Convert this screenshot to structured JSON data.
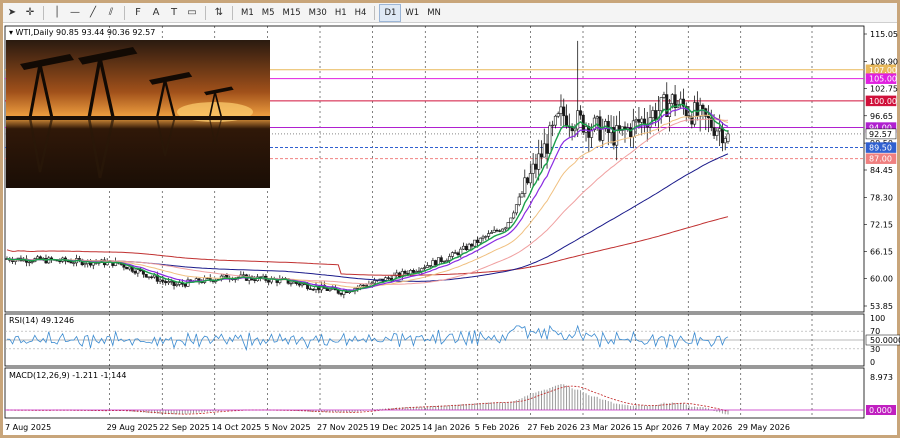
{
  "toolbar": {
    "tools": [
      {
        "name": "cursor-icon",
        "glyph": "➤"
      },
      {
        "name": "crosshair-icon",
        "glyph": "✛"
      },
      {
        "name": "vertical-line-icon",
        "glyph": "│"
      },
      {
        "name": "horizontal-line-icon",
        "glyph": "—"
      },
      {
        "name": "trendline-icon",
        "glyph": "╱"
      },
      {
        "name": "equidistant-channel-icon",
        "glyph": "⫽"
      },
      {
        "name": "fibonacci-icon",
        "glyph": "F"
      },
      {
        "name": "text-icon",
        "glyph": "A"
      },
      {
        "name": "text-label-icon",
        "glyph": "T"
      },
      {
        "name": "rectangle-label-icon",
        "glyph": "▭"
      },
      {
        "name": "arrows-icon",
        "glyph": "⇅"
      }
    ],
    "timeframes_intraday": [
      "M1",
      "M5",
      "M15",
      "M30",
      "H1",
      "H4"
    ],
    "timeframes_daily": [
      "D1",
      "W1",
      "MN"
    ],
    "active_timeframe": "D1"
  },
  "chart": {
    "header_label": "WTI,Daily",
    "header_values": "90.85 93.44 90.36 92.57",
    "price_ticks": [
      "115.05",
      "108.90",
      "102.75",
      "96.65",
      "90.50",
      "84.45",
      "78.30",
      "72.15",
      "66.15",
      "60.00",
      "53.85"
    ],
    "price_tags": [
      {
        "text": "107.00",
        "bg": "#e8b85a",
        "fg": "#ffffff"
      },
      {
        "text": "105.00",
        "bg": "#e020e0",
        "fg": "#ffffff"
      },
      {
        "text": "100.00",
        "bg": "#d0103a",
        "fg": "#ffffff"
      },
      {
        "text": "94.00",
        "bg": "#b020d0",
        "fg": "#ffffff"
      },
      {
        "text": "92.57",
        "bg": "#ffffff",
        "fg": "#000000"
      },
      {
        "text": "89.50",
        "bg": "#3060d0",
        "fg": "#ffffff"
      },
      {
        "text": "87.00",
        "bg": "#f08080",
        "fg": "#ffffff"
      }
    ]
  },
  "rsi": {
    "label": "RSI(14) 49.1246",
    "ticks": [
      "100",
      "70",
      "50.0000",
      "30",
      "0"
    ],
    "current_value": 49.12
  },
  "macd": {
    "label": "MACD(12,26,9) -1.211 -1.144",
    "ticks": [
      "8.973",
      "0.000"
    ]
  },
  "dates": [
    "7 Aug 2025",
    "29 Aug 2025",
    "22 Sep 2025",
    "14 Oct 2025",
    "5 Nov 2025",
    "27 Nov 2025",
    "19 Dec 2025",
    "14 Jan 2026",
    "5 Feb 2026",
    "27 Feb 2026",
    "23 Mar 2026",
    "15 Apr 2026",
    "7 May 2026",
    "29 May 2026"
  ],
  "colors": {
    "frame": "#c8a57a",
    "bull": "#1a1a1a",
    "ema_fast": "#1aa04a",
    "ema_mid": "#8a2be2",
    "sma_50": "#f0a0a0",
    "sma_100": "#1a1a8a",
    "sma_200": "#c03030",
    "rsi_line": "#3a8ad0",
    "macd_hist": "#999999",
    "macd_signal": "#c02020"
  },
  "chart_data": {
    "type": "candlestick",
    "symbol": "WTI",
    "timeframe": "Daily",
    "last_bar": {
      "open": 90.85,
      "high": 93.44,
      "low": 90.36,
      "close": 92.57
    },
    "key_levels": [
      107.0,
      105.0,
      100.0,
      94.0,
      92.57,
      89.5,
      87.0
    ],
    "ylim": [
      53.85,
      115.05
    ],
    "approx_closes": [
      {
        "date": "7 Aug 2025",
        "close": 64.5
      },
      {
        "date": "29 Aug 2025",
        "close": 64.0
      },
      {
        "date": "22 Sep 2025",
        "close": 63.5
      },
      {
        "date": "14 Oct 2025",
        "close": 58.5
      },
      {
        "date": "5 Nov 2025",
        "close": 60.5
      },
      {
        "date": "27 Nov 2025",
        "close": 59.5
      },
      {
        "date": "19 Dec 2025",
        "close": 57.0
      },
      {
        "date": "14 Jan 2026",
        "close": 60.5
      },
      {
        "date": "5 Feb 2026",
        "close": 65.0
      },
      {
        "date": "27 Feb 2026",
        "close": 72.0
      },
      {
        "date": "23 Mar 2026",
        "close": 97.0
      },
      {
        "date": "15 Apr 2026",
        "close": 92.0
      },
      {
        "date": "7 May 2026",
        "close": 100.0
      },
      {
        "date": "29 May 2026",
        "close": 92.57
      }
    ]
  }
}
